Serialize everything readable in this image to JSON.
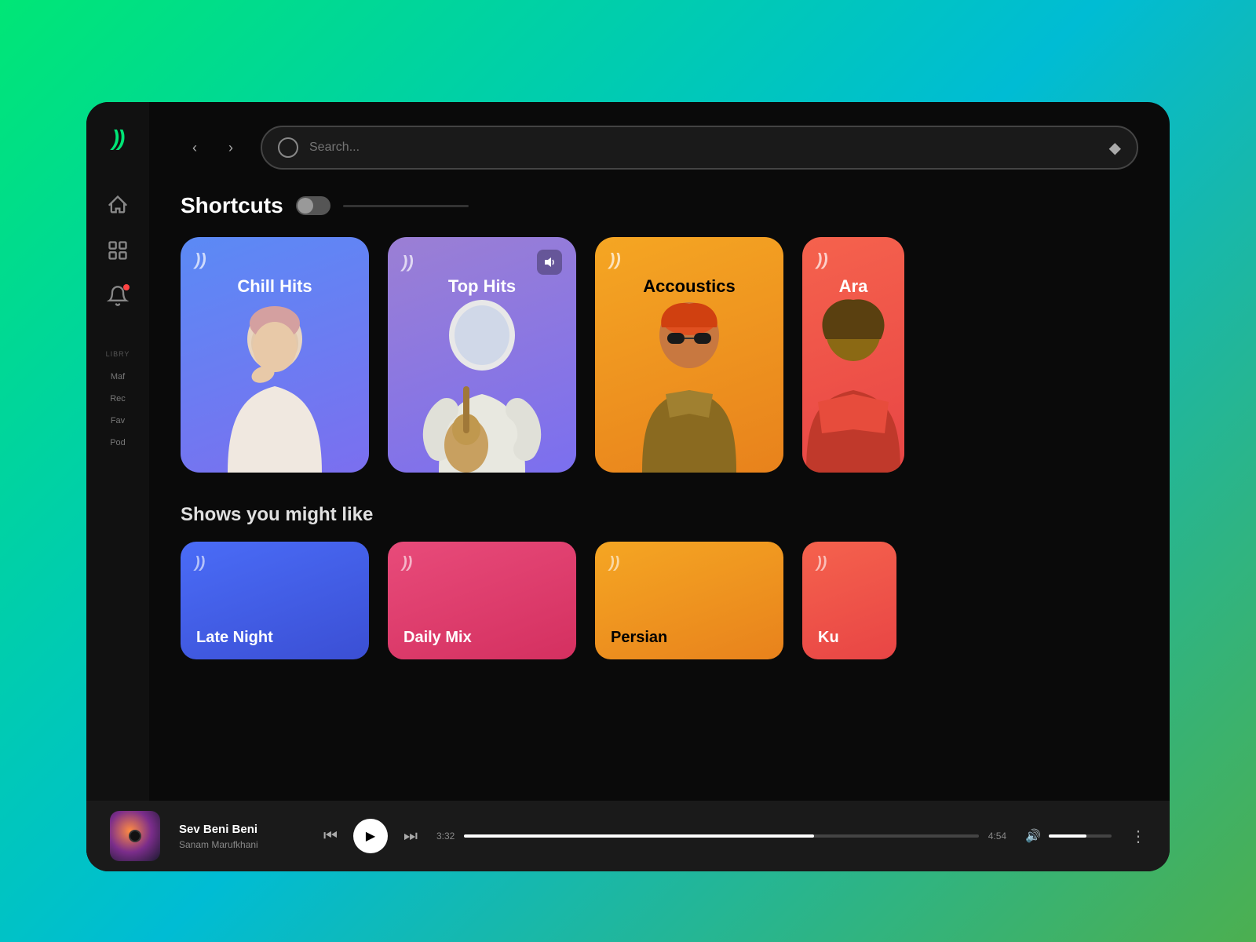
{
  "app": {
    "logo": "))",
    "background_gradient": "linear-gradient(135deg, #00e676, #00bcd4)"
  },
  "nav": {
    "back_label": "<",
    "forward_label": ">",
    "search_placeholder": "Search..."
  },
  "sidebar": {
    "library_label": "LIBRY",
    "items": [
      {
        "id": "home",
        "label": "Home",
        "icon": "home"
      },
      {
        "id": "browse",
        "label": "Browse",
        "icon": "grid"
      },
      {
        "id": "notifications",
        "label": "Notifications",
        "icon": "bell",
        "badge": true
      },
      {
        "id": "maf",
        "label": "Maf"
      },
      {
        "id": "rec",
        "label": "Rec"
      },
      {
        "id": "fav",
        "label": "Fav"
      },
      {
        "id": "pod",
        "label": "Pod"
      }
    ]
  },
  "shortcuts": {
    "section_title": "Shortcuts",
    "cards": [
      {
        "id": "chill-hits",
        "title": "Chill Hits",
        "color_start": "#5b8af5",
        "color_end": "#7b6fef",
        "bg_class": "card-bg-blue",
        "playing": false
      },
      {
        "id": "top-hits",
        "title": "Top Hits",
        "color_start": "#9b7fd4",
        "color_end": "#7b6fef",
        "bg_class": "card-bg-purple",
        "playing": true
      },
      {
        "id": "accoustics",
        "title": "Accoustics",
        "color_start": "#f5a623",
        "color_end": "#e8821c",
        "bg_class": "card-bg-orange",
        "playing": false
      },
      {
        "id": "arabic",
        "title": "Ara",
        "color_start": "#f5624d",
        "color_end": "#e84545",
        "bg_class": "card-bg-red-orange",
        "playing": false,
        "partial": true
      }
    ]
  },
  "shows": {
    "section_title": "Shows you might like",
    "cards": [
      {
        "id": "late-night",
        "title": "Late Night",
        "color_start": "#4a6cf7",
        "color_end": "#3b4fd4",
        "bg_class": "card-bg-dark-blue"
      },
      {
        "id": "daily-mix",
        "title": "Daily Mix",
        "color_start": "#e84b7a",
        "color_end": "#d43060",
        "bg_class": "card-bg-pink"
      },
      {
        "id": "persian",
        "title": "Persian",
        "color_start": "#f5a623",
        "color_end": "#e8821c",
        "bg_class": "card-bg-orange"
      },
      {
        "id": "ku",
        "title": "Ku",
        "color_start": "#f5624d",
        "color_end": "#e84545",
        "bg_class": "card-bg-red-orange",
        "partial": true
      }
    ]
  },
  "player": {
    "title": "Sev Beni Beni",
    "artist": "Sanam Marufkhani",
    "current_time": "3:32",
    "total_time": "4:54",
    "progress_percent": 68,
    "volume_percent": 60
  }
}
